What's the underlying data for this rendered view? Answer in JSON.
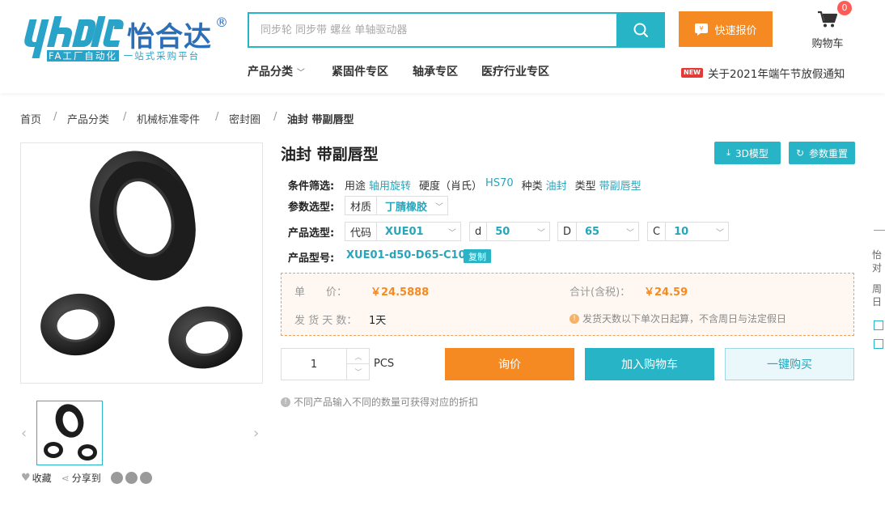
{
  "header": {
    "logo_cn": "怡合达",
    "logo_reg": "®",
    "logo_tagline_prefix": "FA工厂自动化",
    "logo_tagline_suffix": "一站式采购平台",
    "search_placeholder": "同步轮 同步带 螺丝 单轴驱动器",
    "quote_label": "快速报价",
    "cart_label": "购物车",
    "cart_count": "0",
    "nav": [
      "产品分类",
      "紧固件专区",
      "轴承专区",
      "医疗行业专区"
    ],
    "notice_tag": "NEW",
    "notice_text": "关于2021年端午节放假通知"
  },
  "breadcrumb": [
    "首页",
    "产品分类",
    "机械标准零件",
    "密封圈",
    "油封 带副唇型"
  ],
  "product": {
    "title": "油封 带副唇型",
    "btn_3d": "3D模型",
    "btn_reset": "参数重置",
    "filter_label": "条件筛选:",
    "filters": [
      {
        "k": "用途",
        "v": "轴用旋转"
      },
      {
        "k": "硬度（肖氏）",
        "v": "HS70"
      },
      {
        "k": "种类",
        "v": "油封"
      },
      {
        "k": "类型",
        "v": "带副唇型"
      }
    ],
    "param_label": "参数选型:",
    "param": {
      "k": "材质",
      "v": "丁腈橡胶"
    },
    "select_label": "产品选型:",
    "selects": [
      {
        "k": "代码",
        "v": "XUE01"
      },
      {
        "k": "d",
        "v": "50"
      },
      {
        "k": "D",
        "v": "65"
      },
      {
        "k": "C",
        "v": "10"
      }
    ],
    "model_label": "产品型号:",
    "model_value": "XUE01-d50-D65-C10",
    "copy_label": "复制"
  },
  "price": {
    "unit_label": "单　　价：",
    "unit_price": "￥24.5888",
    "total_label": "合计(含税)：",
    "total_price": "￥24.59",
    "ship_label": "发 货 天 数：",
    "ship_days": "1天",
    "ship_note": "发货天数以下单次日起算，不含周日与法定假日"
  },
  "purchase": {
    "qty": "1",
    "unit": "PCS",
    "inquire": "询价",
    "add_cart": "加入购物车",
    "buy_now": "一键购买",
    "discount_note": "不同产品输入不同的数量可获得对应的折扣"
  },
  "gallery": {
    "favorite": "收藏",
    "share": "分享到"
  },
  "side_fragments": [
    "怡",
    "对",
    "周",
    "日"
  ],
  "colors": {
    "teal": "#27b4c6",
    "orange": "#f68a22",
    "brand_blue": "#2a6fb8"
  }
}
